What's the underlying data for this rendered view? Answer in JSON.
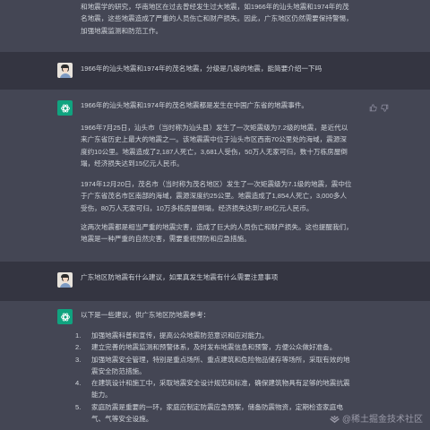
{
  "conversation": {
    "top_para": {
      "l1": "和地震学的研究，华南地区在过去曾经发生过大地震，如1966年的汕头地震和1974年的茂",
      "l2": "名地震，这些地震造成了严重的人员伤亡和财产损失。因此，广东地区仍然需要保持警惕，",
      "l3": "加强地震监测和防范工作。"
    },
    "q1": "1966年的汕头地震和1974年的茂名地震，分级是几级的地震，能简要介绍一下吗",
    "a1": {
      "intro": "1966年的汕头地震和1974年的茂名地震都是发生在中国广东省的地震事件。",
      "p1": {
        "l1": "1966年7月25日，汕头市（当时称为汕头县）发生了一次矩震级为7.2级的地震，是近代以",
        "l2": "来广东省历史上最大的地震之一。该地震震中位于汕头市区西南70公里处的海域，震源深",
        "l3": "度约10公里。地震造成了2,187人死亡，3,681人受伤，50万人无家可归，数十万栋房屋倒",
        "l4": "塌，经济损失达到15亿元人民币。"
      },
      "p2": {
        "l1": "1974年12月20日，茂名市（当时称为茂名地区）发生了一次矩震级为7.1级的地震，震中位",
        "l2": "于广东省茂名市区南部的海域，震源深度约25公里。地震造成了1,854人死亡，3,000多人",
        "l3": "受伤，80万人无家可归，10万多栋房屋倒塌，经济损失达到7.85亿元人民币。"
      },
      "p3": {
        "l1": "这两次地震都是相当严重的地震灾害，造成了巨大的人员伤亡和财产损失。这也提醒我们，",
        "l2": "地震是一种严重的自然灾害，需要重视预防和应急措施。"
      }
    },
    "q2": "广东地区防地震有什么建议，如果真发生地震有什么需要注意事项",
    "a2": {
      "intro": "以下是一些建议，供广东地区防地震参考：",
      "items": [
        {
          "num": "1.",
          "l1": "加强地震科普和宣传，提高公众地震防范意识和应对能力。",
          "l2": ""
        },
        {
          "num": "2.",
          "l1": "建立完善的地震监测和预警体系，及时发布地震信息和预警，方便公众做好准备。",
          "l2": ""
        },
        {
          "num": "3.",
          "l1": "加强地震安全管理，特别是重点场所、重点建筑和危险物品储存等场所，采取有效的地",
          "l2": "震安全防范措施。"
        },
        {
          "num": "4.",
          "l1": "在建筑设计和施工中，采取地震安全设计规范和标准，确保建筑物具有足够的地震抗震",
          "l2": "能力。"
        },
        {
          "num": "5.",
          "l1": "家庭防震是重要的一环，家庭应制定防震应急预案，储备防震物资，定期检查家庭电",
          "l2": "气、气等安全设施。"
        }
      ]
    }
  },
  "watermark": "@稀土掘金技术社区",
  "colors": {
    "assistant_bg": "#444654",
    "user_bg": "#343541",
    "gpt_green": "#10a37f",
    "text": "#d1d5db"
  }
}
